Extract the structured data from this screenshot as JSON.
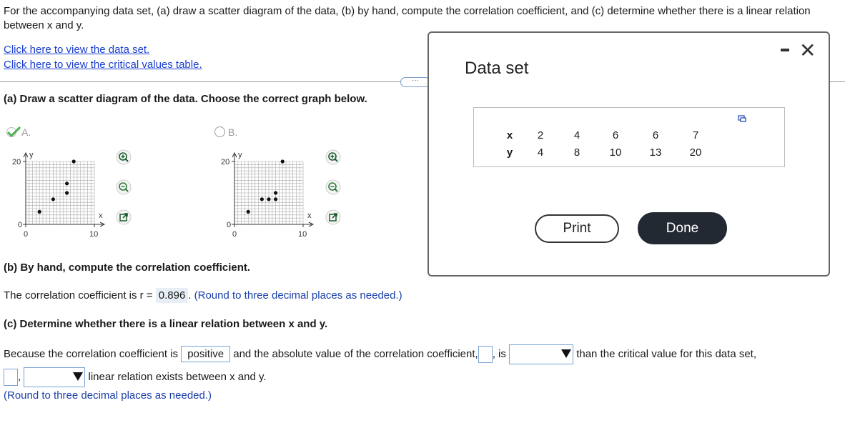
{
  "question": {
    "text": "For the accompanying data set, (a) draw a scatter diagram of the data, (b) by hand, compute the correlation coefficient, and (c) determine whether there is a linear relation between x and y."
  },
  "links": {
    "data_set": "Click here to view the data set.",
    "critical_values": "Click here to view the critical values table."
  },
  "more_button": "···",
  "part_a": {
    "prompt": "(a) Draw a scatter diagram of the data. Choose the correct graph below.",
    "options": [
      {
        "label": "A.",
        "selected": true
      },
      {
        "label": "B.",
        "selected": false
      }
    ],
    "axis": {
      "y_label": "y",
      "x_label": "x",
      "y_tick_top": "20",
      "y_tick_zero": "0",
      "x_tick_zero": "0",
      "x_tick_ten": "10"
    },
    "graph_a_points": [
      [
        2,
        4
      ],
      [
        4,
        8
      ],
      [
        6,
        10
      ],
      [
        6,
        13
      ],
      [
        7,
        20
      ]
    ],
    "graph_b_points": [
      [
        2,
        4
      ],
      [
        4,
        8
      ],
      [
        5,
        8
      ],
      [
        6,
        8
      ],
      [
        6,
        10
      ],
      [
        7,
        20
      ]
    ]
  },
  "part_b": {
    "prompt": "(b) By hand, compute the correlation coefficient.",
    "answer_prefix": "The correlation coefficient is r =",
    "answer_value": "0.896",
    "answer_suffix": ".",
    "hint": "(Round to three decimal places as needed.)"
  },
  "part_c": {
    "prompt": "(c) Determine whether there is a linear relation between x and y.",
    "line1_a": "Because the correlation coefficient is",
    "line1_positive": "positive",
    "line1_b": "and the absolute value of the correlation coefficient,",
    "line1_c": ", is",
    "line1_d": "than the critical value for this data set,",
    "line2_comma": ",",
    "line2_text": "linear relation exists between x and y.",
    "hint": "(Round to three decimal places as needed.)"
  },
  "modal": {
    "title": "Data set",
    "table": {
      "x_header": "x",
      "y_header": "y",
      "x_values": [
        "2",
        "4",
        "6",
        "6",
        "7"
      ],
      "y_values": [
        "4",
        "8",
        "10",
        "13",
        "20"
      ]
    },
    "print_button": "Print",
    "done_button": "Done"
  },
  "colors": {
    "link": "#1a3fcf",
    "answer_bg": "#e8eef6",
    "check": "#4caf50",
    "done_bg": "#232932"
  }
}
